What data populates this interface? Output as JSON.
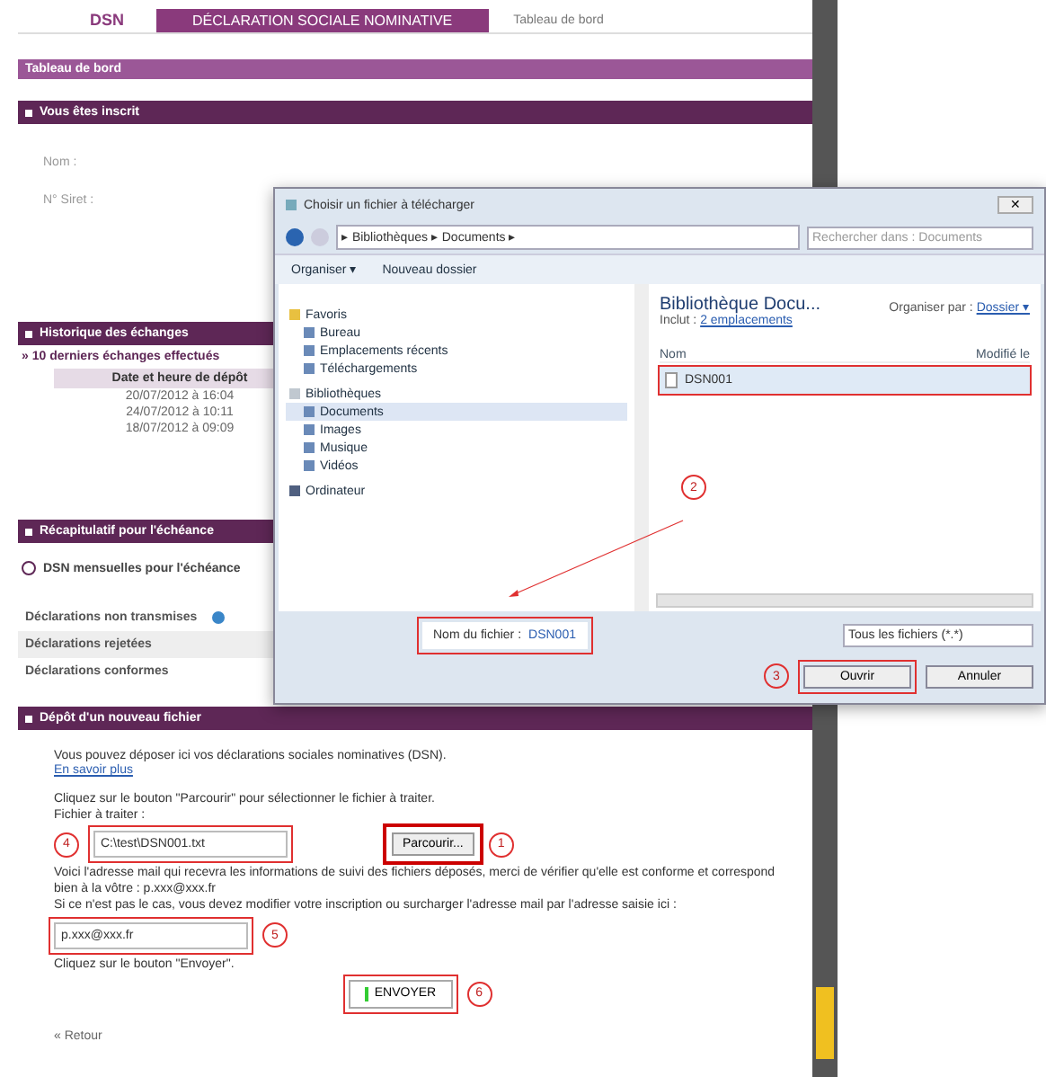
{
  "header": {
    "logo": "DSN",
    "title": "DÉCLARATION SOCIALE NOMINATIVE",
    "link": "Tableau de bord"
  },
  "page_title": "Tableau de bord",
  "registered": {
    "title": "Vous êtes inscrit",
    "fields": [
      "Nom :",
      "N° Siret :"
    ]
  },
  "history": {
    "title": "Historique des échanges",
    "summary": "» 10 derniers échanges effectués",
    "column": "Date et heure de dépôt",
    "rows": [
      "20/07/2012 à 16:04",
      "24/07/2012 à 10:11",
      "18/07/2012 à 09:09"
    ]
  },
  "recap": {
    "title": "Récapitulatif pour l'échéance",
    "subtitle": "DSN mensuelles pour l'échéance",
    "items": [
      {
        "label": "Déclarations non transmises",
        "info": true
      },
      {
        "label": "Déclarations rejetées",
        "info": false
      },
      {
        "label": "Déclarations conformes",
        "info": false
      }
    ]
  },
  "upload": {
    "title": "Dépôt d'un nouveau fichier",
    "intro": "Vous pouvez déposer ici vos déclarations sociales nominatives (DSN).",
    "link": "En savoir plus",
    "instruction": "Cliquez sur le bouton \"Parcourir\" pour sélectionner le fichier à traiter.",
    "file_label": "Fichier à traiter :",
    "file_value": "C:\\test\\DSN001.txt",
    "file_step": "4",
    "browse": "Parcourir...",
    "browse_step": "1",
    "email_text": "Voici l'adresse mail qui recevra les informations de suivi des fichiers déposés, merci de vérifier qu'elle est conforme et correspond bien à la vôtre : p.xxx@xxx.fr",
    "email_note": "Si ce n'est pas le cas, vous devez modifier votre inscription ou surcharger l'adresse mail par l'adresse saisie ici :",
    "email_value": "p.xxx@xxx.fr",
    "email_step": "5",
    "send_instruction": "Cliquez sur le bouton \"Envoyer\".",
    "send": "ENVOYER",
    "send_step": "6",
    "back": "« Retour"
  },
  "dialog": {
    "title": "Choisir un fichier à télécharger",
    "close": "✕",
    "path": "▸ Bibliothèques ▸ Documents ▸",
    "search_placeholder": "Rechercher dans : Documents",
    "toolbar": [
      "Organiser ▾",
      "Nouveau dossier"
    ],
    "nav": [
      {
        "label": "Favoris",
        "selected": false,
        "children": [
          {
            "label": "Bureau",
            "selected": false
          },
          {
            "label": "Emplacements récents",
            "selected": false
          },
          {
            "label": "Téléchargements",
            "selected": false
          }
        ]
      },
      {
        "label": "Bibliothèques",
        "selected": false,
        "children": [
          {
            "label": "Documents",
            "selected": true
          },
          {
            "label": "Images",
            "selected": false
          },
          {
            "label": "Musique",
            "selected": false
          },
          {
            "label": "Vidéos",
            "selected": false
          }
        ]
      },
      {
        "label": "Ordinateur",
        "selected": false
      }
    ],
    "library_title": "Bibliothèque Docu...",
    "library_sub": "Inclut :",
    "library_link": "2 emplacements",
    "arrange_label": "Organiser par :",
    "arrange_value": "Dossier ▾",
    "columns": [
      "Nom",
      "Modifié le"
    ],
    "files": [
      {
        "name": "DSN001",
        "selected": true
      }
    ],
    "selected_step": "2",
    "filename_label": "Nom du fichier :",
    "filename_value": "DSN001",
    "filetype": "Tous les fichiers (*.*)",
    "open": "Ouvrir",
    "open_step": "3",
    "cancel": "Annuler"
  }
}
